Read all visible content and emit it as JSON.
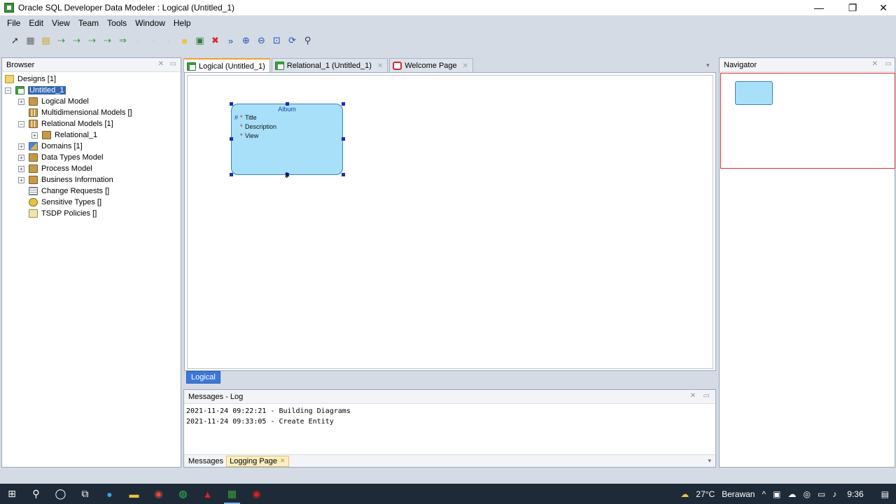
{
  "window": {
    "title": "Oracle SQL Developer Data Modeler : Logical (Untitled_1)",
    "minimize_glyph": "—",
    "restore_glyph": "❐",
    "close_glyph": "✕"
  },
  "menu": [
    "File",
    "Edit",
    "View",
    "Team",
    "Tools",
    "Window",
    "Help"
  ],
  "toolbar": {
    "icons": [
      "select-pointer-icon",
      "new-entity-icon",
      "new-view-icon",
      "new-relation-1n-icon",
      "new-relation-11-icon",
      "new-relation-mn-icon",
      "new-relation-nn-icon",
      "new-arc-icon",
      "new-type-icon",
      "new-subtype-icon",
      "new-note-icon",
      "new-folder-icon",
      "new-picture-icon",
      "delete-icon",
      "engineer-to-relational-icon",
      "zoom-in-icon",
      "zoom-out-icon",
      "fit-screen-icon",
      "refresh-icon",
      "find-icon"
    ],
    "glyphs": [
      "➚",
      "▦",
      "▤",
      "⇢",
      "⇢",
      "⇢",
      "⇢",
      "⇒",
      "▫",
      "▫",
      "▫",
      "■",
      "▣",
      "✖",
      "»",
      "⊕",
      "⊖",
      "⊡",
      "⟳",
      "⚲"
    ],
    "colors": [
      "#333333",
      "#6a6a6a",
      "#c9a21e",
      "#3a9a3a",
      "#3a9a3a",
      "#3a9a3a",
      "#3a9a3a",
      "#3a9a3a",
      "#a8b0bc",
      "#a8b0bc",
      "#a8b0bc",
      "#e9c83a",
      "#2f7a3a",
      "#d62b2b",
      "#2050c0",
      "#2050c0",
      "#2050c0",
      "#2050c0",
      "#2050c0",
      "#2b3b5a"
    ]
  },
  "browser": {
    "title": "Browser",
    "tree": [
      {
        "label": "Designs [1]",
        "icon": "folder-icon",
        "level": 0,
        "expander": ""
      },
      {
        "label": "Untitled_1",
        "icon": "design-icon",
        "level": 0,
        "expander": "−",
        "selected": true
      },
      {
        "label": "Logical Model",
        "icon": "logical-model-icon",
        "level": 1,
        "expander": "+"
      },
      {
        "label": "Multidimensional Models []",
        "icon": "multidimensional-icon",
        "level": 1,
        "expander": ""
      },
      {
        "label": "Relational Models [1]",
        "icon": "relational-models-icon",
        "level": 1,
        "expander": "−"
      },
      {
        "label": "Relational_1",
        "icon": "relational-model-icon",
        "level": 2,
        "expander": "+"
      },
      {
        "label": "Domains [1]",
        "icon": "domains-icon",
        "level": 1,
        "expander": "+"
      },
      {
        "label": "Data Types Model",
        "icon": "data-types-icon",
        "level": 1,
        "expander": "+"
      },
      {
        "label": "Process Model",
        "icon": "process-model-icon",
        "level": 1,
        "expander": "+"
      },
      {
        "label": "Business Information",
        "icon": "business-info-icon",
        "level": 1,
        "expander": "+"
      },
      {
        "label": "Change Requests []",
        "icon": "change-requests-icon",
        "level": 1,
        "expander": ""
      },
      {
        "label": "Sensitive Types []",
        "icon": "sensitive-types-icon",
        "level": 1,
        "expander": ""
      },
      {
        "label": "TSDP Policies []",
        "icon": "tsdp-policies-icon",
        "level": 1,
        "expander": ""
      }
    ]
  },
  "editor_tabs": [
    {
      "label": "Logical (Untitled_1)",
      "active": true,
      "icon": "logical-diagram-icon"
    },
    {
      "label": "Relational_1 (Untitled_1)",
      "active": false,
      "icon": "relational-diagram-icon"
    },
    {
      "label": "Welcome Page",
      "active": false,
      "icon": "welcome-page-icon"
    }
  ],
  "entity": {
    "name": "Album",
    "attributes": [
      {
        "pk": "#",
        "req": "*",
        "name": "Title"
      },
      {
        "pk": "",
        "req": "*",
        "name": "Description"
      },
      {
        "pk": "",
        "req": "*",
        "name": "View"
      }
    ]
  },
  "canvas_tab": "Logical",
  "messages": {
    "title": "Messages - Log",
    "lines": [
      "2021-11-24 09:22:21 - Building Diagrams",
      "2021-11-24 09:33:05 - Create Entity"
    ],
    "tabs": [
      "Messages",
      "Logging Page"
    ]
  },
  "navigator": {
    "title": "Navigator"
  },
  "taskbar": {
    "weather": "27°C",
    "weather_text": "Berawan",
    "time": "9:36"
  }
}
